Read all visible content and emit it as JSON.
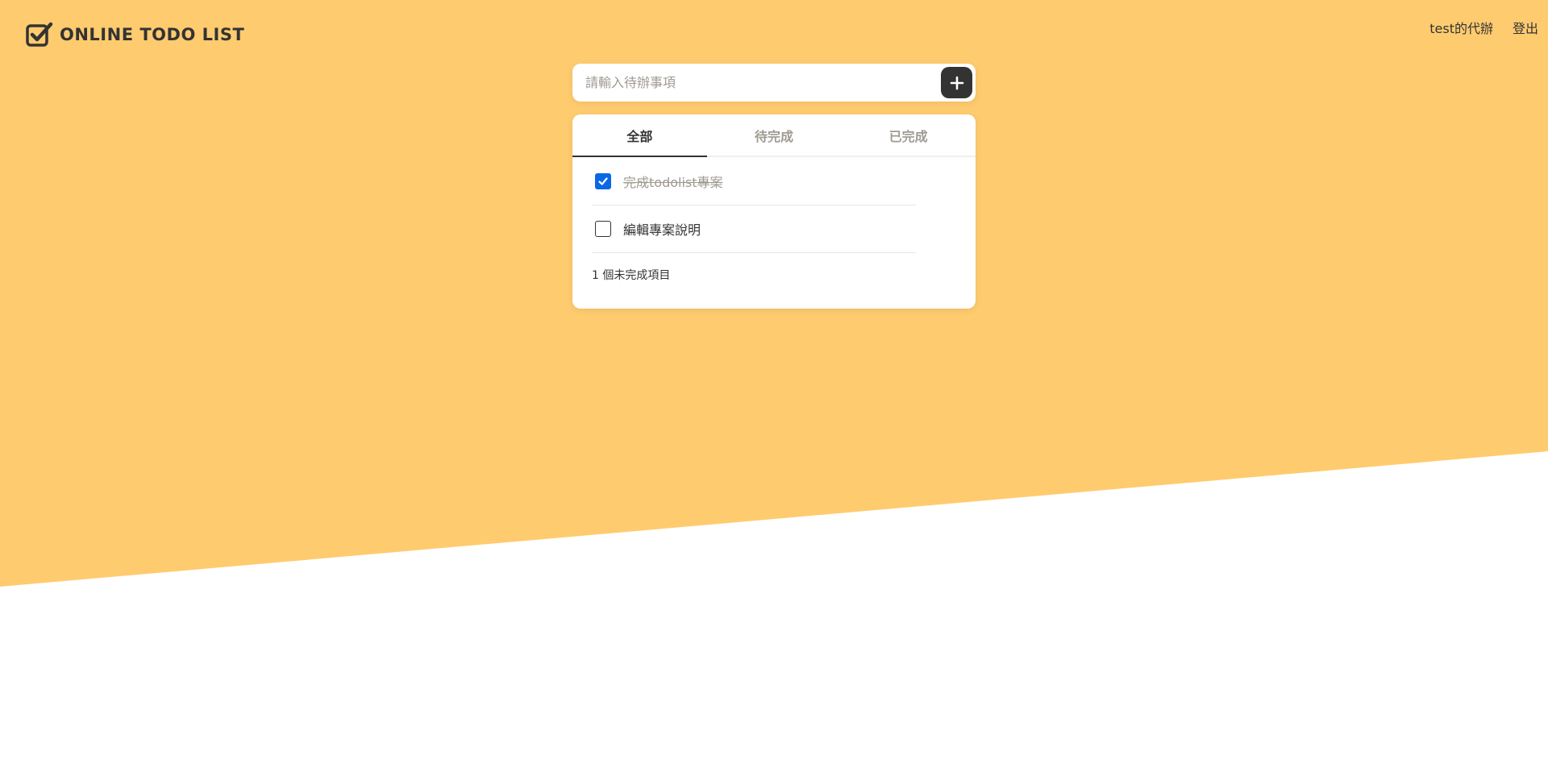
{
  "header": {
    "logo_text": "ONLINE TODO LIST",
    "user_label": "test的代辦",
    "logout_label": "登出"
  },
  "input": {
    "placeholder": "請輸入待辦事項",
    "value": "",
    "add_icon": "plus-icon"
  },
  "tabs": [
    {
      "label": "全部",
      "active": true
    },
    {
      "label": "待完成",
      "active": false
    },
    {
      "label": "已完成",
      "active": false
    }
  ],
  "todos": [
    {
      "label": "完成todolist專案",
      "completed": true
    },
    {
      "label": "編輯專案說明",
      "completed": false
    }
  ],
  "summary": {
    "remaining_text": "1 個未完成項目"
  },
  "colors": {
    "background": "#FFCB6F",
    "primary_dark": "#333333",
    "muted_text": "#9F9A91",
    "checkbox_checked": "#0A68E6"
  }
}
